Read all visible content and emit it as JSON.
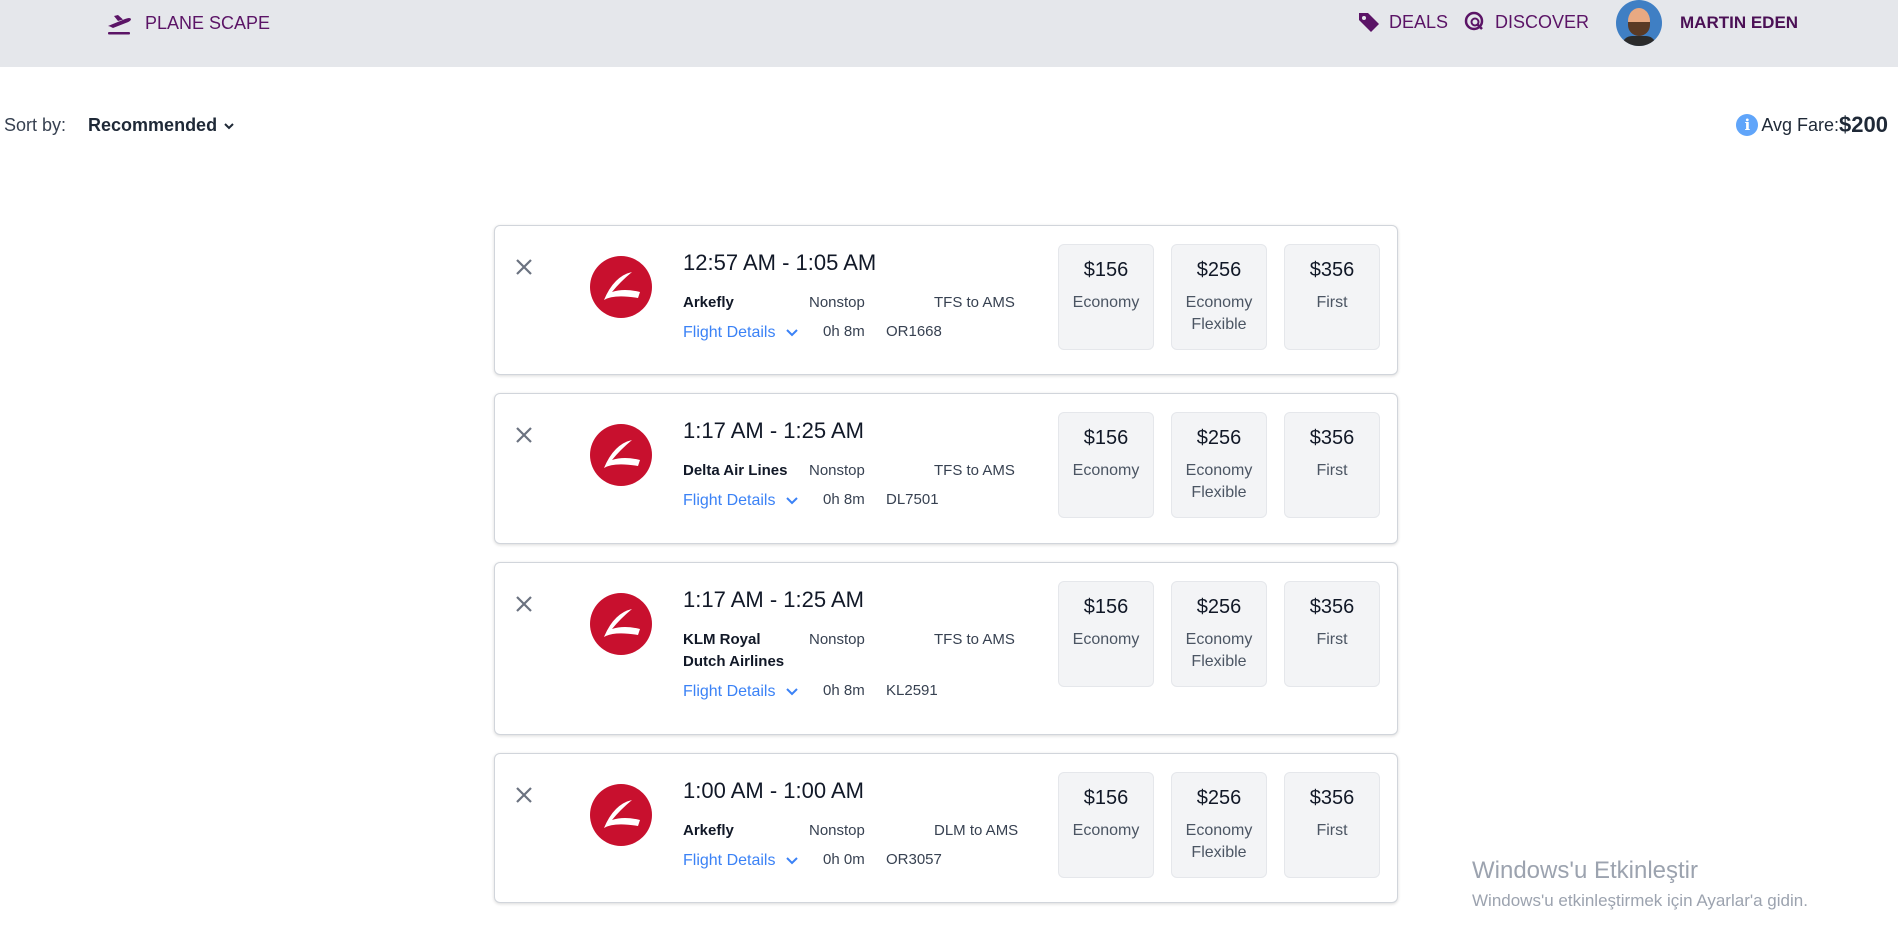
{
  "header": {
    "brand": "PLANE SCAPE",
    "deals": "DEALS",
    "discover": "DISCOVER",
    "user_name": "MARTIN EDEN"
  },
  "sort": {
    "label": "Sort by:",
    "value": "Recommended"
  },
  "avg_fare": {
    "label": "Avg Fare:",
    "value": "$200"
  },
  "flights": [
    {
      "times": "12:57 AM - 1:05 AM",
      "airline": "Arkefly",
      "stops": "Nonstop",
      "route": "TFS to AMS",
      "details": "Flight Details",
      "duration": "0h 8m",
      "flight_no": "OR1668",
      "fares": [
        {
          "price": "$156",
          "class": "Economy"
        },
        {
          "price": "$256",
          "class": "Economy Flexible"
        },
        {
          "price": "$356",
          "class": "First"
        }
      ]
    },
    {
      "times": "1:17 AM - 1:25 AM",
      "airline": "Delta Air Lines",
      "stops": "Nonstop",
      "route": "TFS to AMS",
      "details": "Flight Details",
      "duration": "0h 8m",
      "flight_no": "DL7501",
      "fares": [
        {
          "price": "$156",
          "class": "Economy"
        },
        {
          "price": "$256",
          "class": "Economy Flexible"
        },
        {
          "price": "$356",
          "class": "First"
        }
      ]
    },
    {
      "times": "1:17 AM - 1:25 AM",
      "airline": "KLM Royal Dutch Airlines",
      "stops": "Nonstop",
      "route": "TFS to AMS",
      "details": "Flight Details",
      "duration": "0h 8m",
      "flight_no": "KL2591",
      "fares": [
        {
          "price": "$156",
          "class": "Economy"
        },
        {
          "price": "$256",
          "class": "Economy Flexible"
        },
        {
          "price": "$356",
          "class": "First"
        }
      ]
    },
    {
      "times": "1:00 AM - 1:00 AM",
      "airline": "Arkefly",
      "stops": "Nonstop",
      "route": "DLM to AMS",
      "details": "Flight Details",
      "duration": "0h 0m",
      "flight_no": "OR3057",
      "fares": [
        {
          "price": "$156",
          "class": "Economy"
        },
        {
          "price": "$256",
          "class": "Economy Flexible"
        },
        {
          "price": "$356",
          "class": "First"
        }
      ]
    }
  ],
  "watermark": {
    "title": "Windows'u Etkinleştir",
    "subtitle": "Windows'u etkinleştirmek için Ayarlar'a gidin."
  },
  "colors": {
    "brand": "#5b1466",
    "link": "#3b82f6",
    "airline_logo": "#c8102e",
    "topbar": "#e5e7eb"
  }
}
